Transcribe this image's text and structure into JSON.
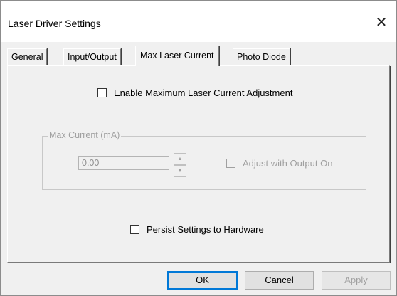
{
  "window": {
    "title": "Laser Driver Settings",
    "close_glyph": "✕"
  },
  "tabs": [
    {
      "label": "General",
      "active": false
    },
    {
      "label": "Input/Output",
      "active": false
    },
    {
      "label": "Max Laser Current",
      "active": true
    },
    {
      "label": "Photo Diode",
      "active": false
    }
  ],
  "max_current_tab": {
    "enable_checkbox": {
      "label": "Enable Maximum Laser Current Adjustment",
      "checked": false
    },
    "group": {
      "legend": "Max Current (mA)",
      "value": "0.00",
      "spin_up": "▲",
      "spin_down": "▼",
      "adjust_checkbox": {
        "label": "Adjust with Output On",
        "checked": false,
        "enabled": false
      }
    },
    "persist_checkbox": {
      "label": "Persist Settings to Hardware",
      "checked": false
    }
  },
  "buttons": {
    "ok": "OK",
    "cancel": "Cancel",
    "apply": "Apply"
  },
  "colors": {
    "accent": "#0078d7",
    "disabled_text": "#a0a0a0"
  }
}
